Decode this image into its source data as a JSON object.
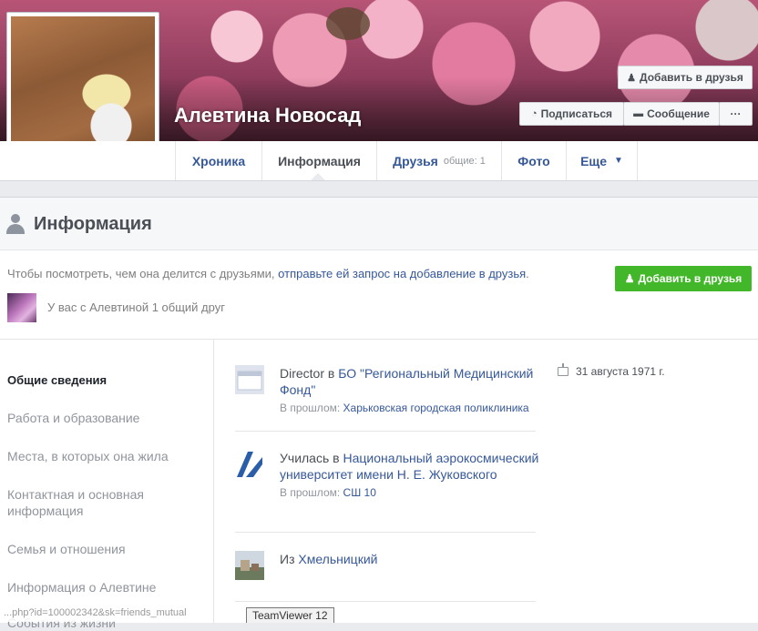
{
  "profile": {
    "name": "Алевтина Новосад"
  },
  "header_actions": {
    "add_friend": "Добавить в друзья",
    "subscribe": "Подписаться",
    "message": "Сообщение",
    "more": "···"
  },
  "tabs": [
    {
      "label": "Хроника"
    },
    {
      "label": "Информация"
    },
    {
      "label": "Друзья",
      "sub": "общие: 1"
    },
    {
      "label": "Фото"
    },
    {
      "label": "Еще"
    }
  ],
  "section": {
    "title": "Информация"
  },
  "notice": {
    "text": "Чтобы посмотреть, чем она делится с друзьями, ",
    "link": "отправьте ей запрос на добавление в друзья",
    "end": ".",
    "add_friend_button": "Добавить в друзья"
  },
  "mutual": {
    "text": "У вас с Алевтиной 1 общий друг"
  },
  "sidebar": {
    "items": [
      {
        "label": "Общие сведения"
      },
      {
        "label": "Работа и образование"
      },
      {
        "label": "Места, в которых она жила"
      },
      {
        "label": "Контактная и основная информация"
      },
      {
        "label": "Семья и отношения"
      },
      {
        "label": "Информация о Алевтине"
      },
      {
        "label": "События из жизни"
      }
    ]
  },
  "entries": {
    "work": {
      "prefix": "Director в ",
      "org": "БО \"Региональный Медицинский Фонд\"",
      "prev_label": "В прошлом: ",
      "prev": "Харьковская городская поликлиника"
    },
    "education": {
      "prefix": "Училась в ",
      "org": "Национальный аэрокосмический университет имени Н. Е. Жуковского",
      "prev_label": "В прошлом: ",
      "prev": "СШ 10"
    },
    "from": {
      "prefix": "Из ",
      "place": "Хмельницкий"
    }
  },
  "birthday": "31 августа 1971 г.",
  "statusbar": {
    "url": "...php?id=100002342&sk=friends_mutual",
    "teamviewer": "TeamViewer 12"
  },
  "colors": {
    "link": "#365899",
    "green_button": "#42b72a"
  }
}
